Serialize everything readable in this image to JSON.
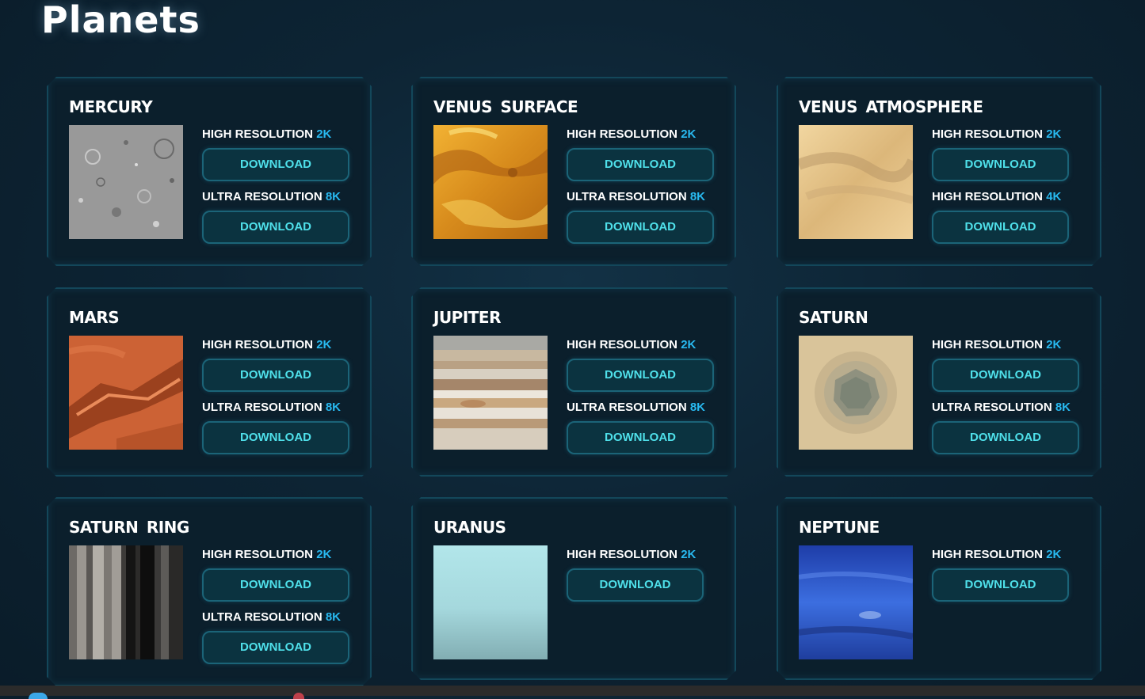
{
  "page": {
    "title": "Planets"
  },
  "colors": {
    "accent_size": "#28b9f0",
    "button_text": "#4fe0ea",
    "card_border": "#13475a"
  },
  "cards": [
    {
      "name": "MERCURY",
      "texture": "mercury-texture",
      "options": [
        {
          "label": "HIGH RESOLUTION",
          "size": "2K",
          "button": "DOWNLOAD"
        },
        {
          "label": "ULTRA RESOLUTION",
          "size": "8K",
          "button": "DOWNLOAD"
        }
      ]
    },
    {
      "name": "VENUS SURFACE",
      "texture": "venus-surface-texture",
      "options": [
        {
          "label": "HIGH RESOLUTION",
          "size": "2K",
          "button": "DOWNLOAD"
        },
        {
          "label": "ULTRA RESOLUTION",
          "size": "8K",
          "button": "DOWNLOAD"
        }
      ]
    },
    {
      "name": "VENUS ATMOSPHERE",
      "texture": "venus-atmosphere-texture",
      "options": [
        {
          "label": "HIGH RESOLUTION",
          "size": "2K",
          "button": "DOWNLOAD"
        },
        {
          "label": "HIGH RESOLUTION",
          "size": "4K",
          "button": "DOWNLOAD"
        }
      ]
    },
    {
      "name": "MARS",
      "texture": "mars-texture",
      "options": [
        {
          "label": "HIGH RESOLUTION",
          "size": "2K",
          "button": "DOWNLOAD"
        },
        {
          "label": "ULTRA RESOLUTION",
          "size": "8K",
          "button": "DOWNLOAD"
        }
      ]
    },
    {
      "name": "JUPITER",
      "texture": "jupiter-texture",
      "options": [
        {
          "label": "HIGH RESOLUTION",
          "size": "2K",
          "button": "DOWNLOAD"
        },
        {
          "label": "ULTRA RESOLUTION",
          "size": "8K",
          "button": "DOWNLOAD"
        }
      ]
    },
    {
      "name": "SATURN",
      "texture": "saturn-texture",
      "options": [
        {
          "label": "HIGH RESOLUTION",
          "size": "2K",
          "button": "DOWNLOAD"
        },
        {
          "label": "ULTRA RESOLUTION",
          "size": "8K",
          "button": "DOWNLOAD"
        }
      ]
    },
    {
      "name": "SATURN RING",
      "texture": "saturn-ring-texture",
      "options": [
        {
          "label": "HIGH RESOLUTION",
          "size": "2K",
          "button": "DOWNLOAD"
        },
        {
          "label": "ULTRA RESOLUTION",
          "size": "8K",
          "button": "DOWNLOAD"
        }
      ]
    },
    {
      "name": "URANUS",
      "texture": "uranus-texture",
      "options": [
        {
          "label": "HIGH RESOLUTION",
          "size": "2K",
          "button": "DOWNLOAD"
        }
      ]
    },
    {
      "name": "NEPTUNE",
      "texture": "neptune-texture",
      "options": [
        {
          "label": "HIGH RESOLUTION",
          "size": "2K",
          "button": "DOWNLOAD"
        }
      ]
    }
  ]
}
